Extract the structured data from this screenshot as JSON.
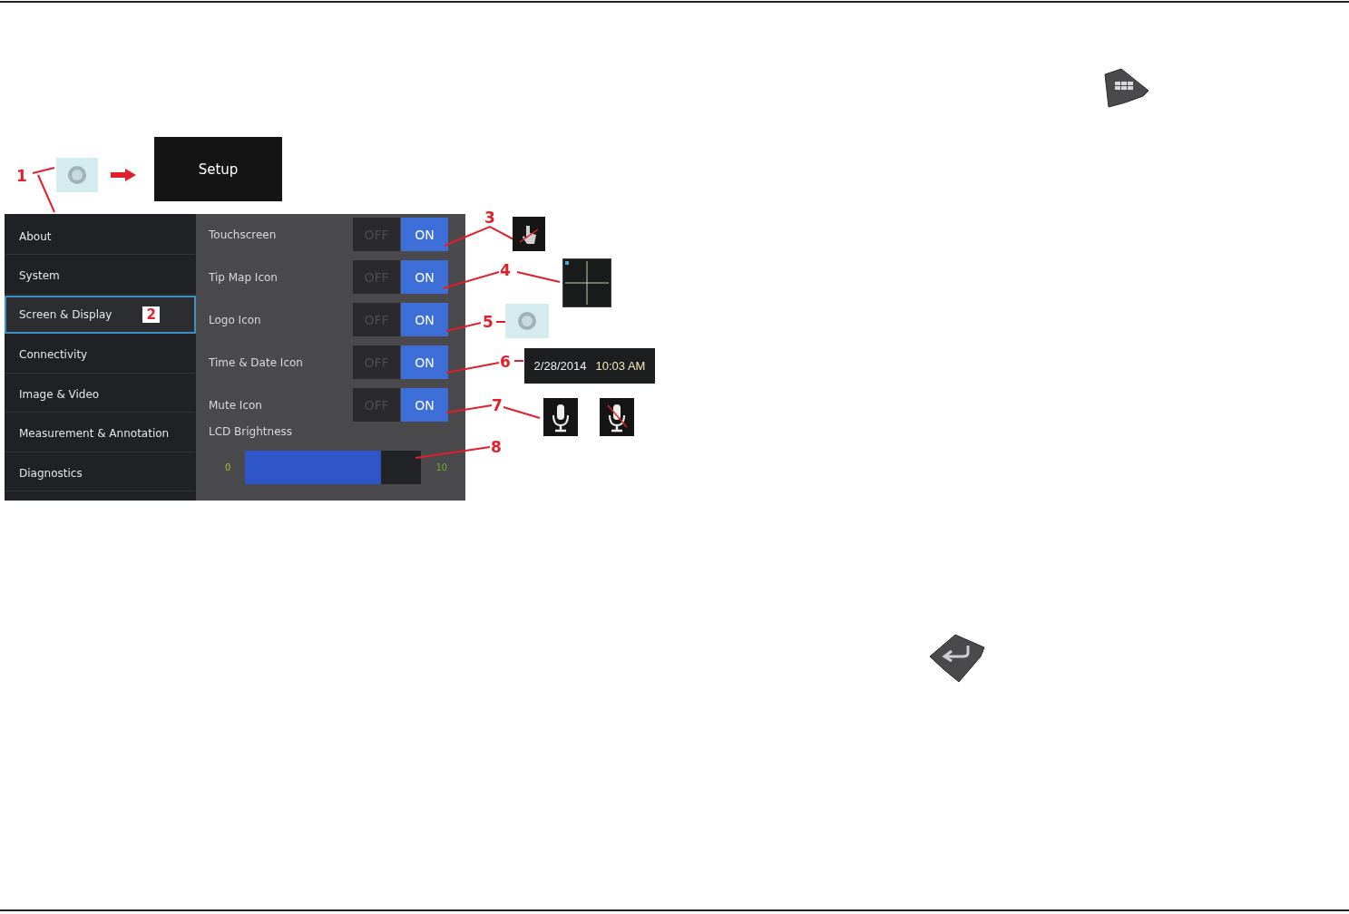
{
  "setup_button": {
    "label": "Setup"
  },
  "sidebar": {
    "items": [
      {
        "label": "About",
        "selected": false
      },
      {
        "label": "System",
        "selected": false
      },
      {
        "label": "Screen & Display",
        "selected": true,
        "callout": "2"
      },
      {
        "label": "Connectivity",
        "selected": false
      },
      {
        "label": "Image & Video",
        "selected": false
      },
      {
        "label": "Measurement & Annotation",
        "selected": false
      },
      {
        "label": "Diagnostics",
        "selected": false
      }
    ]
  },
  "settings": [
    {
      "label": "Touchscreen",
      "off_label": "OFF",
      "on_label": "ON",
      "on": true
    },
    {
      "label": "Tip Map Icon",
      "off_label": "OFF",
      "on_label": "ON",
      "on": true
    },
    {
      "label": "Logo Icon",
      "off_label": "OFF",
      "on_label": "ON",
      "on": true
    },
    {
      "label": "Time & Date Icon",
      "off_label": "OFF",
      "on_label": "ON",
      "on": true
    },
    {
      "label": "Mute Icon",
      "off_label": "OFF",
      "on_label": "ON",
      "on": true
    }
  ],
  "brightness": {
    "label": "LCD Brightness",
    "min_label": "0",
    "max_label": "10",
    "level": 0.77
  },
  "datetime_preview": {
    "date": "2/28/2014",
    "time": "10:03 AM"
  },
  "callouts": [
    "1",
    "3",
    "4",
    "5",
    "6",
    "7",
    "8"
  ]
}
